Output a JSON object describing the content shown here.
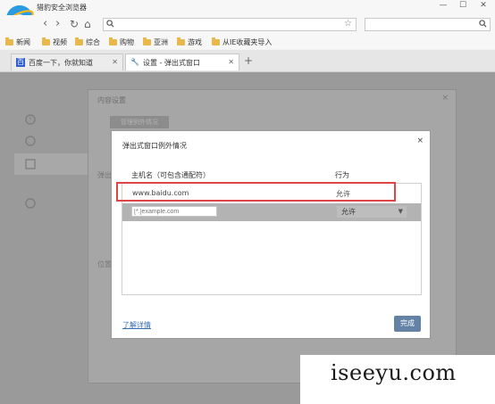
{
  "app": {
    "title": "猎豹安全浏览器"
  },
  "window": {
    "minimize": "—",
    "maximize": "☐",
    "close": "✕"
  },
  "nav": {
    "back": "‹",
    "forward": "›",
    "reload": "↻",
    "home": "⌂",
    "address_value": "",
    "search_value": ""
  },
  "bookmarks": [
    "新闻",
    "视频",
    "综合",
    "购物",
    "亚洲",
    "游戏",
    "从IE收藏夹导入"
  ],
  "tabs": [
    {
      "label": "百度一下，你就知道",
      "active": false
    },
    {
      "label": "设置 - 弹出式窗口",
      "active": true
    }
  ],
  "new_tab": "+",
  "background_dialog": {
    "title": "内容设置",
    "button": "管理例外情况",
    "section_1": "弹出",
    "section_2": "位置",
    "done": "完成",
    "close": "×"
  },
  "sidebar": {
    "items": [
      "",
      "",
      "",
      ""
    ]
  },
  "modal": {
    "title": "弹出式窗口例外情况",
    "close": "×",
    "col_host": "主机名（可包含通配符）",
    "col_action": "行为",
    "rows": [
      {
        "host": "www.baidu.com",
        "action": "允许"
      }
    ],
    "new_row": {
      "placeholder": "[*.]example.com",
      "action": "允许"
    },
    "learn_more": "了解详情",
    "done": "完成"
  },
  "watermark": "iseeyu.com",
  "colors": {
    "highlight": "#e04545",
    "primary_button": "#6482a5",
    "link": "#3a6fb5"
  }
}
